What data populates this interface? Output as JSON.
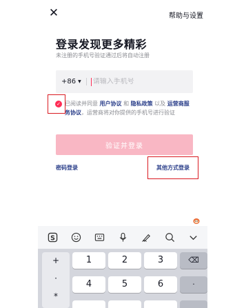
{
  "header": {
    "close_glyph": "✕",
    "help_label": "帮助与设置"
  },
  "main": {
    "title": "登录发现更多精彩",
    "subtitle": "未注册的手机号验证通过后将自动注册",
    "country_code": "+86",
    "phone_placeholder": "请输入手机号",
    "agree_prefix": "已阅读并同意 ",
    "user_agreement": "用户协议",
    "and": " 和 ",
    "privacy_policy": "隐私政策",
    "and2": " 以及 ",
    "carrier_agreement": "运营商服务协议",
    "agree_suffix": "，运营商将对你提供的手机号进行验证",
    "verify_button": "验证并登录",
    "password_login": "密码登录",
    "other_login": "其他方式登录"
  },
  "keyboard": {
    "toolbar_icons": [
      "sogou-icon",
      "emoji-icon",
      "keyboard-icon",
      "mic-icon",
      "handwrite-icon",
      "search-icon",
      "collapse-icon"
    ],
    "side_keys": [
      "+",
      "·",
      "*"
    ],
    "row1": [
      "1",
      "2",
      "3"
    ],
    "row2": [
      "4",
      "5",
      "6"
    ],
    "backspace_glyph": "⌫",
    "dot_key": "·"
  },
  "colors": {
    "accent": "#fe2c55",
    "button_disabled": "#f9b7c4",
    "link": "#2b3f8a",
    "highlight_box": "#d9181f"
  }
}
